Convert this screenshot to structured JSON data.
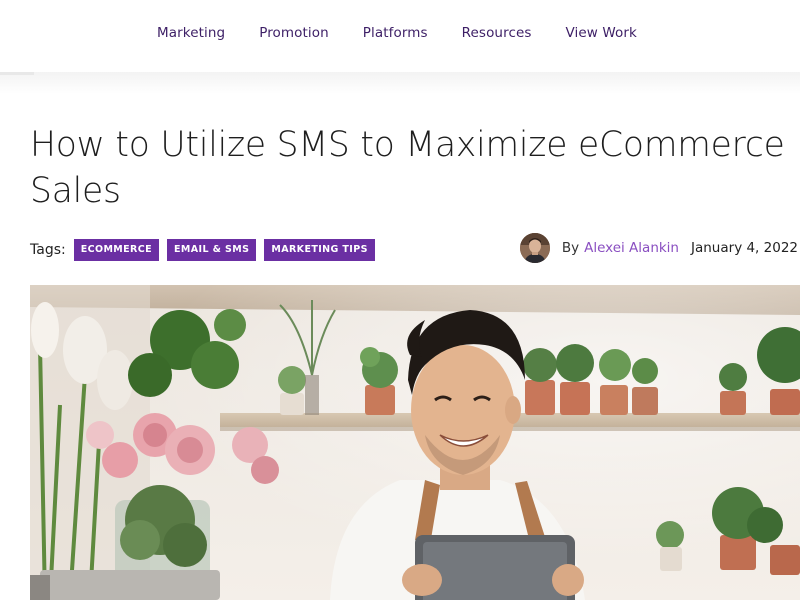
{
  "nav": {
    "items": [
      {
        "label": "Marketing"
      },
      {
        "label": "Promotion"
      },
      {
        "label": "Platforms"
      },
      {
        "label": "Resources"
      },
      {
        "label": "View Work"
      }
    ],
    "color": "#3d1f66"
  },
  "article": {
    "title": "How to Utilize SMS to Maximize eCommerce Sales",
    "tags_label": "Tags:",
    "tags": [
      {
        "label": "ECOMMERCE"
      },
      {
        "label": "EMAIL & SMS"
      },
      {
        "label": "MARKETING TIPS"
      }
    ],
    "tag_color": "#6b2fa3",
    "byline_prefix": "By",
    "author": "Alexei Alankin",
    "author_color": "#8a4fc1",
    "date": "January 4, 2022"
  },
  "hero": {
    "icon": "hero-photo-florist-with-tablet"
  }
}
